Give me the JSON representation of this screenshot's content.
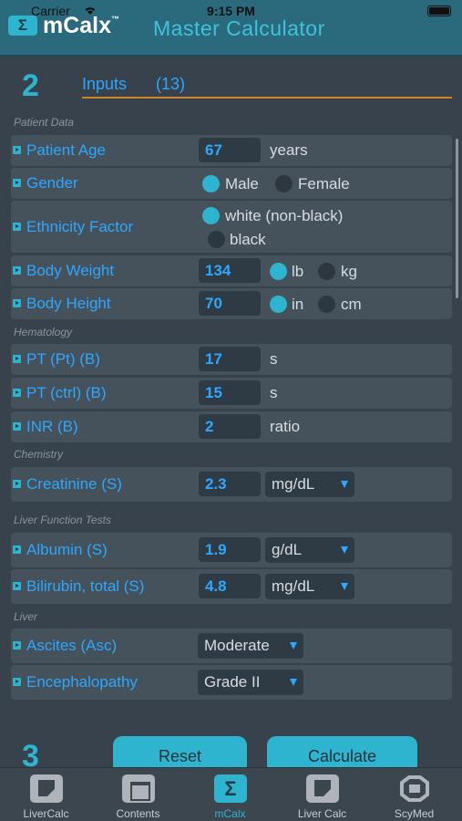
{
  "status_bar": {
    "carrier": "Carrier",
    "time": "9:15 PM"
  },
  "header": {
    "logo_symbol": "Σ",
    "logo_text": "mCalx",
    "trademark": "™",
    "title": "Master Calculator"
  },
  "inputs_section": {
    "number": "2",
    "title": "Inputs",
    "count": "(13)"
  },
  "groups": {
    "patient_data": "Patient Data",
    "hematology": "Hematology",
    "chemistry": "Chemistry",
    "liver_function": "Liver Function Tests",
    "liver": "Liver"
  },
  "fields": {
    "patient_age": {
      "label": "Patient Age",
      "value": "67",
      "unit": "years"
    },
    "gender": {
      "label": "Gender",
      "options": [
        "Male",
        "Female"
      ],
      "selected": "Male"
    },
    "ethnicity": {
      "label": "Ethnicity Factor",
      "options": [
        "white (non-black)",
        "black"
      ],
      "selected": "white (non-black)"
    },
    "body_weight": {
      "label": "Body Weight",
      "value": "134",
      "units": [
        "lb",
        "kg"
      ],
      "selected_unit": "lb"
    },
    "body_height": {
      "label": "Body Height",
      "value": "70",
      "units": [
        "in",
        "cm"
      ],
      "selected_unit": "in"
    },
    "pt_pt": {
      "label": "PT (Pt) (B)",
      "value": "17",
      "unit": "s"
    },
    "pt_ctrl": {
      "label": "PT (ctrl) (B)",
      "value": "15",
      "unit": "s"
    },
    "inr": {
      "label": "INR (B)",
      "value": "2",
      "unit": "ratio"
    },
    "creatinine": {
      "label": "Creatinine (S)",
      "value": "2.3",
      "unit": "mg/dL"
    },
    "albumin": {
      "label": "Albumin (S)",
      "value": "1.9",
      "unit": "g/dL"
    },
    "bilirubin": {
      "label": "Bilirubin, total (S)",
      "value": "4.8",
      "unit": "mg/dL"
    },
    "ascites": {
      "label": "Ascites (Asc)",
      "value": "Moderate"
    },
    "encephalopathy": {
      "label": "Encephalopathy",
      "value": "Grade II"
    }
  },
  "actions": {
    "section_number": "3",
    "reset": "Reset",
    "calculate": "Calculate"
  },
  "tabbar": {
    "tabs": [
      {
        "label": "LiverCalc",
        "icon": "livercalc-icon"
      },
      {
        "label": "Contents",
        "icon": "contents-icon"
      },
      {
        "label": "mCalx",
        "icon": "mcalx-icon",
        "active": true
      },
      {
        "label": "Liver Calc",
        "icon": "liver-calc-icon"
      },
      {
        "label": "ScyMed",
        "icon": "scymed-icon"
      }
    ]
  },
  "colors": {
    "accent": "#2fb4cf",
    "link_blue": "#2ea7ff",
    "header_bg": "#2a6a7c",
    "divider_orange": "#c8862a"
  }
}
